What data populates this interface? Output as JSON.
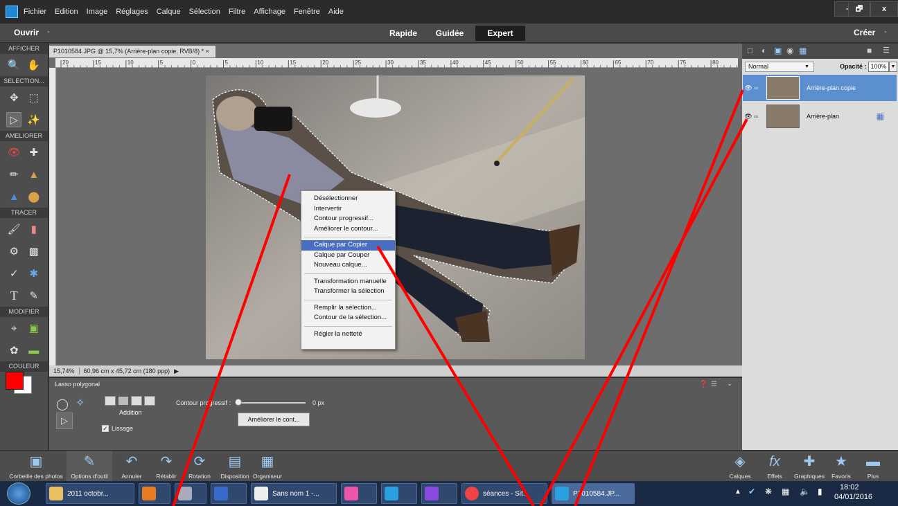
{
  "menu": [
    "Fichier",
    "Edition",
    "Image",
    "Réglages",
    "Calque",
    "Sélection",
    "Filtre",
    "Affichage",
    "Fenêtre",
    "Aide"
  ],
  "window_controls": {
    "minimize": "–",
    "restore": "🗗",
    "close": "x"
  },
  "modebar": {
    "open": "Ouvrir",
    "open_arrow": "-",
    "quick": "Rapide",
    "guided": "Guidée",
    "expert": "Expert",
    "create": "Créer",
    "create_arrow": "-"
  },
  "toolbox": {
    "view": "AFFICHER",
    "select": "SELECTION...",
    "enhance": "AMELIORER",
    "draw": "TRACER",
    "modify": "MODIFIER",
    "color": "COULEUR"
  },
  "document": {
    "tab": "P1010584.JPG @ 15,7% (Arrière-plan copie, RVB/8) * ×",
    "zoom": "15,74%",
    "dims": "60,96 cm x 45,72 cm (180 ppp)",
    "ruler_marks": [
      "20",
      "15",
      "10",
      "5",
      "0",
      "5",
      "10",
      "15",
      "20",
      "25",
      "30",
      "35",
      "40",
      "45",
      "50",
      "55",
      "60",
      "65",
      "70",
      "75",
      "80"
    ]
  },
  "context_menu": {
    "groups": [
      [
        "Désélectionner",
        "Intervertir",
        "Contour progressif...",
        "Améliorer le contour..."
      ],
      [
        "Calque par Copier",
        "Calque par Couper",
        "Nouveau calque..."
      ],
      [
        "Transformation manuelle",
        "Transformer la sélection"
      ],
      [
        "Remplir la sélection...",
        "Contour de la sélection..."
      ],
      [
        "Régler la netteté"
      ]
    ],
    "highlighted": "Calque par Copier"
  },
  "options": {
    "tool_name": "Lasso polygonal",
    "mode_label": "Addition",
    "smooth_label": "Lissage",
    "feather_label": "Contour progressif :",
    "feather_value": "0 px",
    "refine_button": "Améliorer le cont..."
  },
  "layers_panel": {
    "blend_mode": "Normal",
    "opacity_label": "Opacité :",
    "opacity_value": "100%",
    "layers": [
      {
        "name": "Arrière-plan copie",
        "selected": true
      },
      {
        "name": "Arrière-plan",
        "selected": false
      }
    ]
  },
  "bottom_bar": {
    "items": [
      "Corbeille des photos",
      "Options d'outil",
      "Annuler",
      "Rétablir",
      "Rotation",
      "Disposition",
      "Organiseur"
    ],
    "right_items": [
      "Calques",
      "Effets",
      "Graphiques",
      "Favoris",
      "Plus"
    ]
  },
  "taskbar": {
    "items": [
      "2011 octobr...",
      "",
      "",
      "",
      "",
      "Sans nom 1 -...",
      "",
      "",
      "",
      "séances - Sit...",
      "P1010584.JP..."
    ],
    "time": "18:02",
    "date": "04/01/2016"
  },
  "colors": {
    "accent": "#4a6fc2",
    "annotation_red": "#ff0000"
  }
}
